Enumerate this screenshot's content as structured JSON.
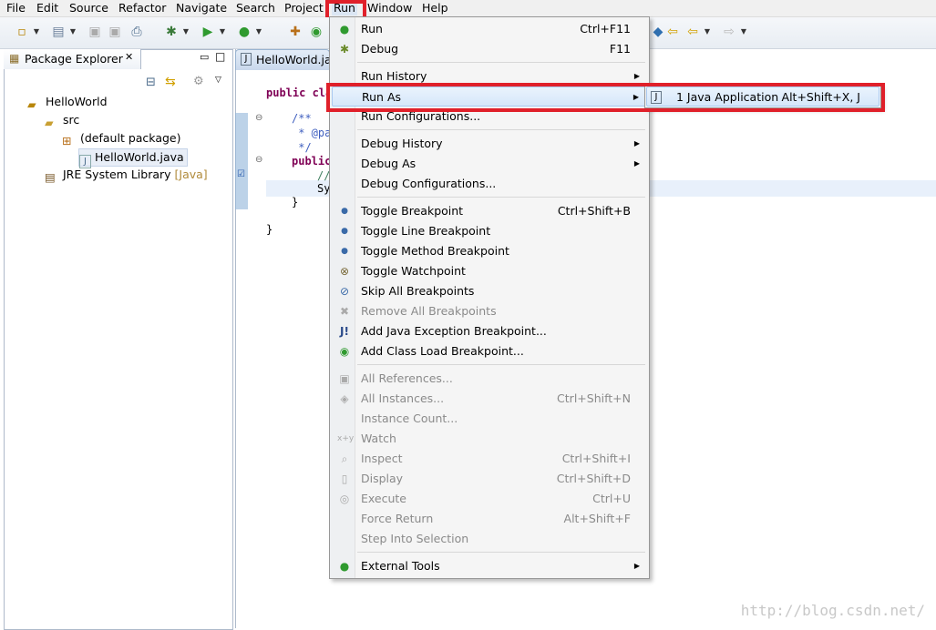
{
  "menubar": [
    "File",
    "Edit",
    "Source",
    "Refactor",
    "Navigate",
    "Search",
    "Project",
    "Run",
    "Window",
    "Help"
  ],
  "package_explorer": {
    "title": "Package Explorer",
    "tree": [
      {
        "label": "HelloWorld",
        "icon": "project-icon"
      },
      {
        "label": "src",
        "icon": "source-folder-icon"
      },
      {
        "label": "(default package)",
        "icon": "package-icon"
      },
      {
        "label": "HelloWorld.java",
        "icon": "java-file-icon"
      },
      {
        "label": "JRE System Library",
        "suffix": "[Java]",
        "icon": "library-icon"
      }
    ]
  },
  "editor": {
    "tab": "HelloWorld.java",
    "lines": [
      "public cla",
      "/**",
      " * @pa",
      " */",
      "public",
      "//",
      "Sy",
      "}",
      "}"
    ]
  },
  "run_menu": {
    "items": [
      {
        "label": "Run",
        "accel": "Ctrl+F11",
        "icon": "run-icon"
      },
      {
        "label": "Debug",
        "accel": "F11",
        "icon": "debug-icon"
      },
      {
        "label": "Run History",
        "submenu": true
      },
      {
        "label": "Run As",
        "submenu": true
      },
      {
        "label": "Run Configurations..."
      },
      {
        "label": "Debug History",
        "submenu": true
      },
      {
        "label": "Debug As",
        "submenu": true
      },
      {
        "label": "Debug Configurations..."
      },
      {
        "label": "Toggle Breakpoint",
        "accel": "Ctrl+Shift+B",
        "icon": "breakpoint-icon"
      },
      {
        "label": "Toggle Line Breakpoint",
        "icon": "breakpoint-icon"
      },
      {
        "label": "Toggle Method Breakpoint",
        "icon": "breakpoint-icon"
      },
      {
        "label": "Toggle Watchpoint",
        "icon": "watchpoint-icon"
      },
      {
        "label": "Skip All Breakpoints",
        "icon": "skip-breakpoints-icon"
      },
      {
        "label": "Remove All Breakpoints",
        "icon": "remove-breakpoints-icon",
        "disabled": true
      },
      {
        "label": "Add Java Exception Breakpoint...",
        "icon": "exception-breakpoint-icon"
      },
      {
        "label": "Add Class Load Breakpoint...",
        "icon": "class-load-icon"
      },
      {
        "label": "All References...",
        "disabled": true
      },
      {
        "label": "All Instances...",
        "accel": "Ctrl+Shift+N",
        "disabled": true
      },
      {
        "label": "Instance Count...",
        "disabled": true
      },
      {
        "label": "Watch",
        "disabled": true
      },
      {
        "label": "Inspect",
        "accel": "Ctrl+Shift+I",
        "disabled": true
      },
      {
        "label": "Display",
        "accel": "Ctrl+Shift+D",
        "disabled": true
      },
      {
        "label": "Execute",
        "accel": "Ctrl+U",
        "disabled": true
      },
      {
        "label": "Force Return",
        "accel": "Alt+Shift+F",
        "disabled": true
      },
      {
        "label": "Step Into Selection",
        "disabled": true
      },
      {
        "label": "External Tools",
        "submenu": true,
        "icon": "external-tools-icon"
      }
    ]
  },
  "run_as_submenu": {
    "items": [
      {
        "label": "1 Java Application",
        "accel": "Alt+Shift+X, J",
        "icon": "java-app-icon"
      }
    ]
  },
  "watermark": "http://blog.csdn.net/",
  "colors": {
    "highlight_red": "#e0202a",
    "menu_bg": "#f5f5f5",
    "hover": "#d6e7fa"
  }
}
